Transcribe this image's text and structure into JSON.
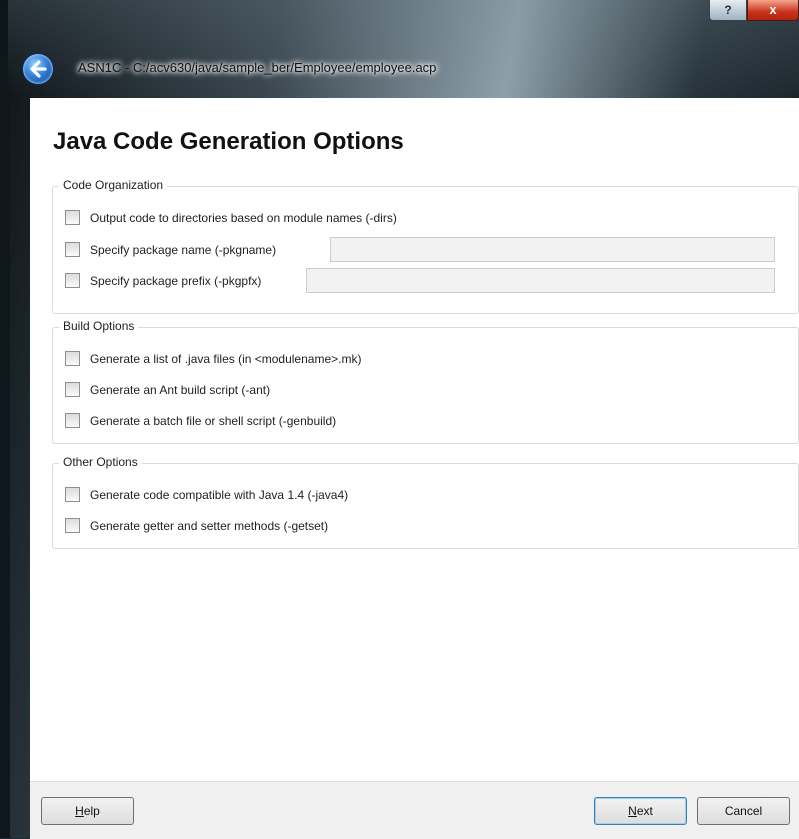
{
  "window": {
    "title": "ASN1C - C:/acv630/java/sample_ber/Employee/employee.acp",
    "help_caption": "?",
    "close_caption": "x"
  },
  "page": {
    "heading": "Java Code Generation Options"
  },
  "groups": {
    "code_org": {
      "title": "Code Organization",
      "dirs": "Output code to directories based on module names (-dirs)",
      "pkgname": "Specify package name (-pkgname)",
      "pkgname_value": "",
      "pkgpfx": "Specify package prefix (-pkgpfx)",
      "pkgpfx_value": ""
    },
    "build": {
      "title": "Build Options",
      "javalist": "Generate a list of .java files (in <modulename>.mk)",
      "ant": "Generate an Ant build script (-ant)",
      "genbuild": "Generate a batch file or shell script (-genbuild)"
    },
    "other": {
      "title": "Other Options",
      "java4": "Generate code compatible with Java 1.4 (-java4)",
      "getset": "Generate getter and setter methods (-getset)"
    }
  },
  "buttons": {
    "help_first": "H",
    "help_rest": "elp",
    "next_first": "N",
    "next_rest": "ext",
    "cancel": "Cancel"
  },
  "colors": {
    "accent": "#3c7fb1",
    "close": "#c9321a"
  },
  "icons": {
    "back": "back-arrow-icon"
  }
}
